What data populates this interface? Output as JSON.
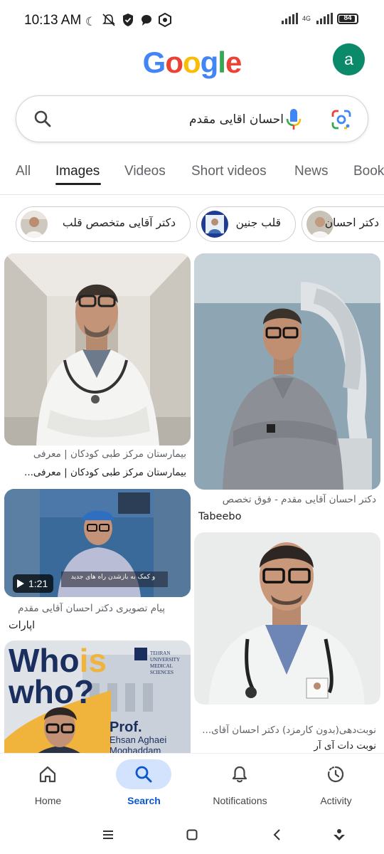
{
  "status_bar": {
    "time": "10:13 AM",
    "network": "4G",
    "battery": "84"
  },
  "logo": {
    "letters": [
      "G",
      "o",
      "o",
      "g",
      "l",
      "e"
    ],
    "colors": [
      "#4285F4",
      "#EA4335",
      "#FBBC05",
      "#4285F4",
      "#34A853",
      "#EA4335"
    ]
  },
  "account": {
    "initial": "a",
    "color": "#0b8a6a"
  },
  "search": {
    "query": "احسان اقایی مقدم"
  },
  "tabs": [
    "All",
    "Images",
    "Videos",
    "Short videos",
    "News",
    "Book"
  ],
  "active_tab": "Images",
  "chips": [
    {
      "label": "دکتر آقایی متخصص قلب"
    },
    {
      "label": "قلب جنین"
    },
    {
      "label": "دکتر احسان"
    }
  ],
  "results": [
    {
      "caption1": "بیمارستان مرکز طبی کودکان | معرفی",
      "caption2": "بیمارستان مرکز طبی کودکان | معرفی..."
    },
    {
      "caption": "دکتر احسان آقایی مقدم - فوق تخصص",
      "source": "Tabeebo"
    },
    {
      "duration": "1:21",
      "overlay_text": "و کمک به بازشدن راه های جدید",
      "caption": "پیام تصویری دکتر احسان آقایی مقدم",
      "source": "آپارات"
    },
    {
      "caption": "نوبت‌دهی(بدون کارمزد) دکتر احسان آقای...",
      "source": "نوبت دات آی آر"
    },
    {
      "headline_a": "Who",
      "headline_b": "is",
      "headline_c": "who?",
      "university_line1": "TEHRAN UNIVERSITY",
      "university_line2": "MEDICAL SCIENCES",
      "prof_line1": "Prof.",
      "prof_line2": "Ehsan Aghaei",
      "prof_line3": "Moghaddam"
    }
  ],
  "bottom_nav": [
    {
      "label": "Home",
      "icon": "home-icon"
    },
    {
      "label": "Search",
      "icon": "search-icon"
    },
    {
      "label": "Notifications",
      "icon": "bell-icon"
    },
    {
      "label": "Activity",
      "icon": "activity-icon"
    }
  ],
  "active_nav": "Search"
}
